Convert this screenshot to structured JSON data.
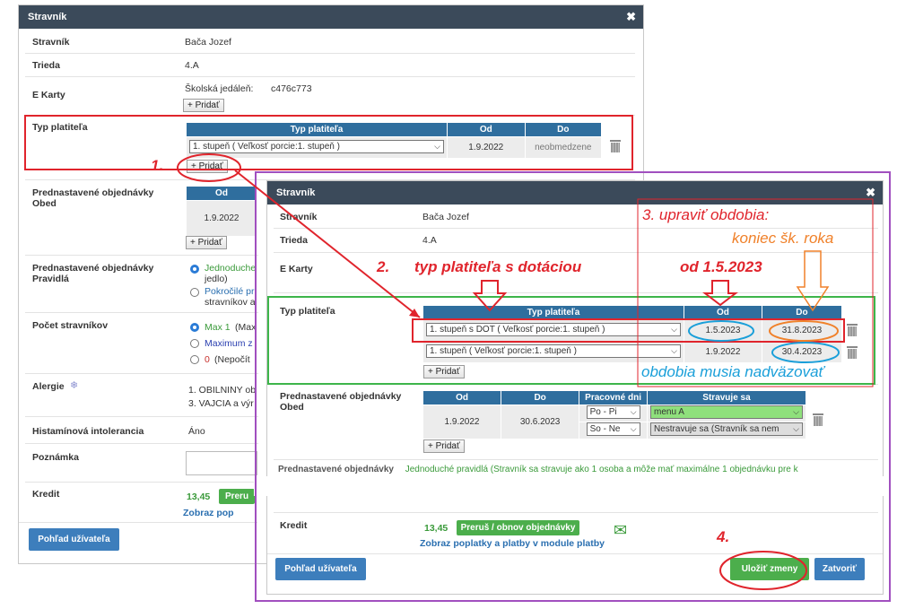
{
  "back": {
    "title": "Stravník",
    "rows": {
      "stravnik_label": "Stravník",
      "stravnik_value": "Bača Jozef",
      "trieda_label": "Trieda",
      "trieda_value": "4.A",
      "ekarty_label": "E Karty",
      "ekarty_type": "Školská jedáleň:",
      "ekarty_code": "c476c773",
      "ekarty_add": "+ Pridať",
      "typ_label": "Typ platiteľa",
      "pred_obed_label": "Prednastavené objednávky Obed",
      "pred_prav_label": "Prednastavené objednávky Pravidlá",
      "pocet_label": "Počet stravníkov",
      "alergie_label": "Alergie",
      "histamin_label": "Histamínová intolerancia",
      "histamin_value": "Áno",
      "poznamka_label": "Poznámka",
      "kredit_label": "Kredit",
      "kredit_value": "13,45",
      "kredit_btn": "Preru",
      "kredit_link": "Zobraz pop"
    },
    "typ_table": {
      "headers": [
        "Typ platiteľa",
        "Od",
        "Do"
      ],
      "row": {
        "select": "1. stupeň ( Veľkosť porcie:1. stupeň )",
        "od": "1.9.2022",
        "do": "neobmedzene"
      },
      "add": "+ Pridať"
    },
    "obed_table": {
      "header": "Od",
      "row": "1.9.2022",
      "add": "+ Pridať"
    },
    "pravidla": {
      "opt1": "Jednoduche",
      "opt1b": "jedlo)",
      "opt2": "Pokročilé pr",
      "opt2b": "stravníkov a"
    },
    "pocet": {
      "opt1": "Max 1",
      "opt1b": "(Max",
      "opt2": "Maximum z",
      "opt3": "0",
      "opt3b": "(Nepočít"
    },
    "alergie": {
      "line1": "1. OBILNINY ob",
      "line2": "3. VAJCIA a výr"
    },
    "user_btn": "Pohľad užívateľa"
  },
  "front": {
    "title": "Stravník",
    "rows": {
      "stravnik_label": "Stravník",
      "stravnik_value": "Bača Jozef",
      "trieda_label": "Trieda",
      "trieda_value": "4.A",
      "ekarty_label": "E Karty",
      "typ_label": "Typ platiteľa",
      "pred_obed_label": "Prednastavené objednávky Obed",
      "pred_prav_partial": "Prednastavené objednávky",
      "pravidla_partial": "Jednoduché pravidlá (Stravník sa stravuje ako 1 osoba a môže mať maximálne 1 objednávku pre k",
      "kredit_label": "Kredit",
      "kredit_value": "13,45",
      "kredit_btn": "Preruš / obnov objednávky",
      "kredit_link": "Zobraz poplatky a platby v module platby"
    },
    "typ_table": {
      "headers": [
        "Typ platiteľa",
        "Od",
        "Do"
      ],
      "rows": [
        {
          "select": "1. stupeň s DOT ( Veľkosť porcie:1. stupeň )",
          "od": "1.5.2023",
          "do": "31.8.2023"
        },
        {
          "select": "1. stupeň ( Veľkosť porcie:1. stupeň )",
          "od": "1.9.2022",
          "do": "30.4.2023"
        }
      ],
      "add": "+ Pridať"
    },
    "obed_table": {
      "headers": [
        "Od",
        "Do",
        "Pracovné dni",
        "Stravuje sa"
      ],
      "od": "1.9.2022",
      "do": "30.6.2023",
      "days": [
        "Po - Pi",
        "So - Ne"
      ],
      "meals": [
        "menu A",
        "Nestravuje sa (Stravník sa nem"
      ],
      "add": "+ Pridať"
    },
    "user_btn": "Pohľad užívateľa",
    "save_btn": "Uložiť zmeny",
    "close_btn": "Zatvoriť"
  },
  "annotations": {
    "a1": "1.",
    "a2": "2.",
    "a2_text": "typ platiteľa s dotáciou",
    "a3": "3. upraviť obdobia:",
    "a3_sub": "koniec šk. roka",
    "a3_from": "od 1.5.2023",
    "a3_note": "obdobia musia nadväzovať",
    "a4": "4."
  },
  "colors": {
    "red": "#e0242c",
    "green": "#3db54a",
    "purple": "#a14fbf",
    "orange": "#f0812a",
    "blue": "#1a9fd9",
    "titlebar": "#3b4a5a",
    "table_header": "#2f6e9e"
  }
}
